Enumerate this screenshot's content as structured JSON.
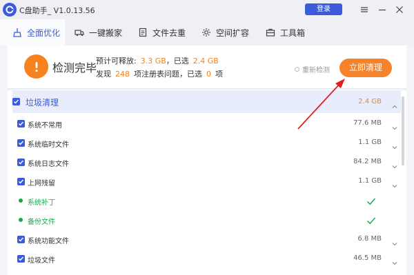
{
  "window": {
    "title": "C盘助手_ V1.0.13.56",
    "login_label": "登录",
    "controls": [
      "menu-icon",
      "minimize-icon",
      "close-icon"
    ]
  },
  "tabs": [
    {
      "label": "全面优化",
      "icon": "broom-icon",
      "active": true
    },
    {
      "label": "一键搬家",
      "icon": "truck-icon",
      "active": false
    },
    {
      "label": "文件去重",
      "icon": "file-icon",
      "active": false
    },
    {
      "label": "空间扩容",
      "icon": "gear-icon",
      "active": false
    },
    {
      "label": "工具箱",
      "icon": "toolbox-icon",
      "active": false
    }
  ],
  "summary": {
    "status_title": "检测完毕",
    "line1_prefix": "预计可释放:",
    "line1_release": "3.3 GB",
    "line1_mid": "，已选",
    "line1_selected": "2.4 GB",
    "line2_prefix": "发现",
    "line2_count": "248",
    "line2_mid": "项注册表问题，已选",
    "line2_selected": "0",
    "line2_suffix": "项",
    "recheck_label": "重新检测",
    "clean_button": "立即清理"
  },
  "group": {
    "label": "垃圾清理",
    "size": "2.4 GB",
    "checked": true
  },
  "items": [
    {
      "label": "系统不常用",
      "size": "77.6 MB",
      "type": "checkbox"
    },
    {
      "label": "系统临时文件",
      "size": "1.1 GB",
      "type": "checkbox"
    },
    {
      "label": "系统日志文件",
      "size": "84.2 MB",
      "type": "checkbox"
    },
    {
      "label": "上网残留",
      "size": "1.1 GB",
      "type": "checkbox"
    },
    {
      "label": "系统补丁",
      "size": "",
      "type": "done"
    },
    {
      "label": "备份文件",
      "size": "",
      "type": "done"
    },
    {
      "label": "系统功能文件",
      "size": "6.8 MB",
      "type": "checkbox"
    },
    {
      "label": "垃圾文件",
      "size": "46.5 MB",
      "type": "checkbox"
    }
  ],
  "colors": {
    "accent_blue": "#3b5bdb",
    "accent_orange": "#f6822a",
    "green": "#1aa84f",
    "annotation_red": "#e02020"
  }
}
